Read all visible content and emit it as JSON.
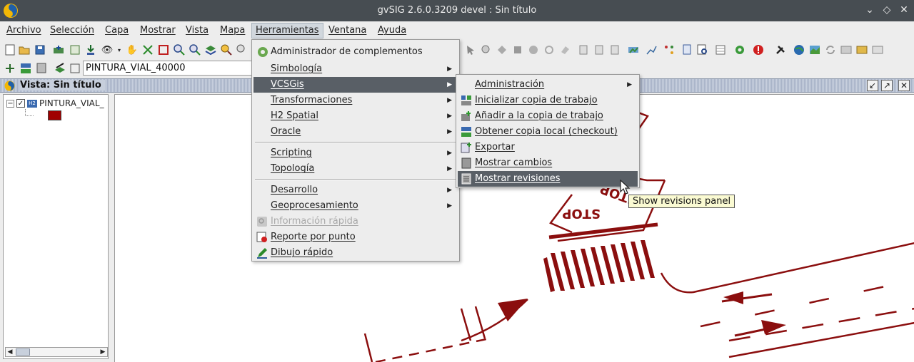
{
  "window": {
    "title": "gvSIG 2.6.0.3209 devel : Sin título"
  },
  "menubar": [
    "Archivo",
    "Selección",
    "Capa",
    "Mostrar",
    "Vista",
    "Mapa",
    "Herramientas",
    "Ventana",
    "Ayuda"
  ],
  "toolbar": {
    "scale_value": "PINTURA_VIAL_40000"
  },
  "view": {
    "title": "Vista: Sin título",
    "layer_name": "PINTURA_VIAL_",
    "layer_badge": "H2",
    "legend_color": "#a00000"
  },
  "herramientas_menu": {
    "items": [
      "Administrador de complementos",
      "Simbología",
      "VCSGis",
      "Transformaciones",
      "H2 Spatial",
      "Oracle",
      "Scripting",
      "Topología",
      "Desarrollo",
      "Geoprocesamiento",
      "Información rápida",
      "Reporte por punto",
      "Dibujo rápido"
    ],
    "highlighted": "VCSGis",
    "disabled": "Información rápida"
  },
  "vcsgis_menu": {
    "items": [
      "Administración",
      "Inicializar copia de trabajo",
      "Añadir a la copia de trabajo",
      "Obtener copia local (checkout)",
      "Exportar",
      "Mostrar cambios",
      "Mostrar revisiones"
    ],
    "highlighted": "Mostrar revisiones"
  },
  "tooltip": "Show revisions panel",
  "map": {
    "sign_text_1": "STOP",
    "sign_text_2": "STOP",
    "line_color": "#8b0e0e"
  },
  "colors": {
    "titlebar": "#474d52",
    "menu_highlight": "#595f66",
    "tooltip_bg": "#fafad2"
  }
}
